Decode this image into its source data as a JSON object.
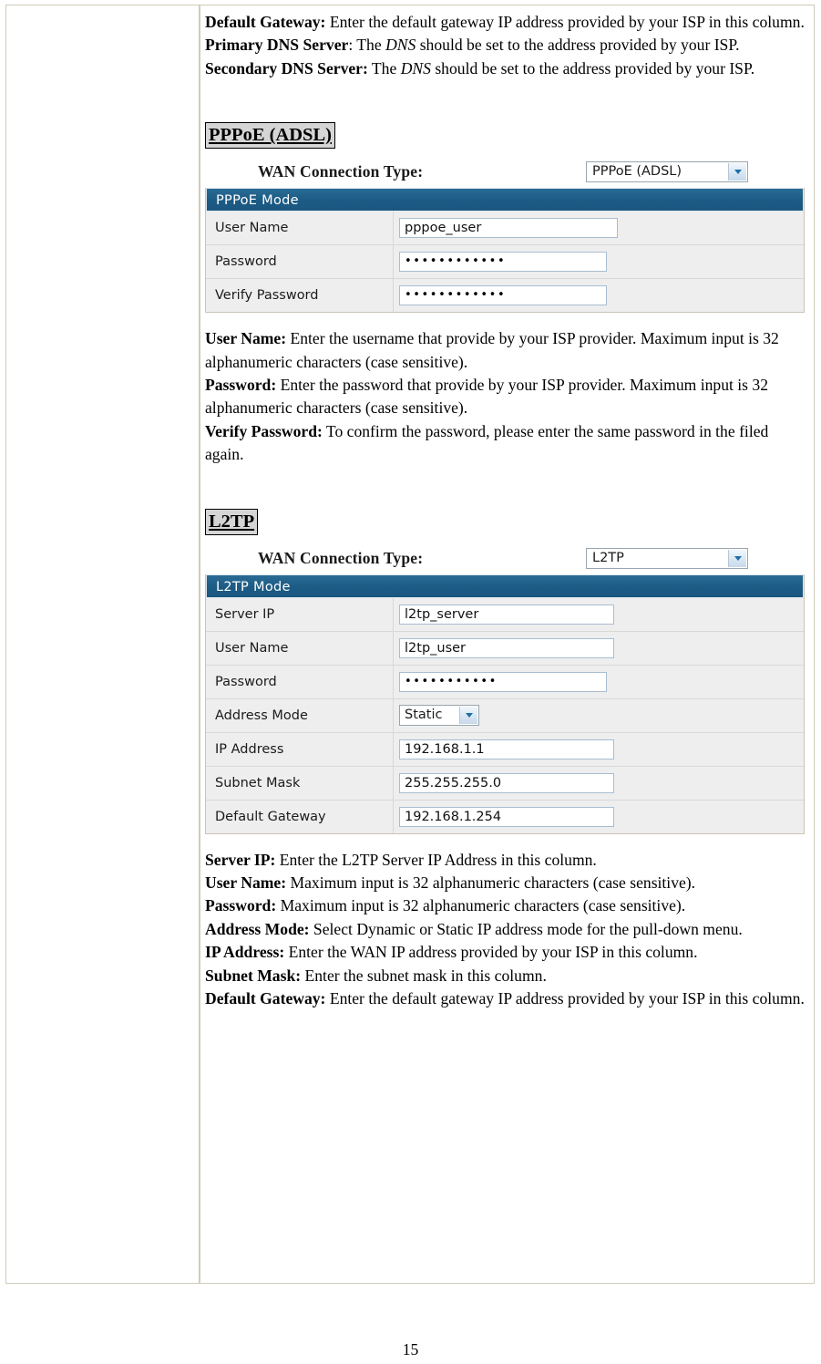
{
  "page": {
    "number": "15"
  },
  "intro": {
    "items": [
      {
        "term": "Default Gateway:",
        "text": " Enter the default gateway IP address provided by your ISP in this column."
      },
      {
        "term": "Primary DNS Server",
        "text_before_em": ": The ",
        "em": "DNS",
        "text_after_em": " should be set to the address provided by your ISP."
      },
      {
        "term": "Secondary DNS Server:",
        "text_before_em": " The ",
        "em": "DNS",
        "text_after_em": " should be set to the address provided by your ISP."
      }
    ]
  },
  "pppoe_section": {
    "heading": "PPPoE (ADSL)",
    "wan_label": "WAN Connection Type:",
    "wan_value": "PPPoE (ADSL)",
    "panel_title": "PPPoE Mode",
    "rows": [
      {
        "label": "User Name",
        "value": "pppoe_user",
        "type": "text"
      },
      {
        "label": "Password",
        "value": "••••••••••••",
        "type": "password"
      },
      {
        "label": "Verify Password",
        "value": "••••••••••••",
        "type": "password"
      }
    ],
    "descriptions": [
      {
        "term": "User Name:",
        "text": " Enter the username that provide by your ISP provider. Maximum input is 32 alphanumeric characters (case sensitive)."
      },
      {
        "term": "Password:",
        "text": " Enter the password that provide by your ISP provider. Maximum input is 32 alphanumeric characters (case sensitive)."
      },
      {
        "term": "Verify Password:",
        "text": " To confirm the password, please enter the same password in the filed again."
      }
    ]
  },
  "l2tp_section": {
    "heading": "L2TP",
    "wan_label": "WAN Connection Type:",
    "wan_value": "L2TP",
    "panel_title": "L2TP Mode",
    "rows": [
      {
        "label": "Server IP",
        "value": "l2tp_server",
        "type": "text"
      },
      {
        "label": "User Name",
        "value": "l2tp_user",
        "type": "text"
      },
      {
        "label": "Password",
        "value": "•••••••••••",
        "type": "password"
      },
      {
        "label": "Address Mode",
        "value": "Static",
        "type": "select"
      },
      {
        "label": "IP Address",
        "value": "192.168.1.1",
        "type": "text"
      },
      {
        "label": "Subnet Mask",
        "value": "255.255.255.0",
        "type": "text"
      },
      {
        "label": "Default Gateway",
        "value": "192.168.1.254",
        "type": "text"
      }
    ],
    "descriptions": [
      {
        "term": "Server IP:",
        "text": " Enter the L2TP Server IP Address in this column."
      },
      {
        "term": "User Name:",
        "text": " Maximum input is 32 alphanumeric characters (case sensitive)."
      },
      {
        "term": "Password:",
        "text": " Maximum input is 32 alphanumeric characters (case sensitive)."
      },
      {
        "term": "Address Mode:",
        "text": " Select Dynamic or Static IP address mode for the pull-down menu."
      },
      {
        "term": "IP Address:",
        "text": " Enter the WAN IP address provided by your ISP in this column."
      },
      {
        "term": "Subnet Mask:",
        "text": " Enter the subnet mask in this column."
      },
      {
        "term": "Default Gateway:",
        "text": " Enter the default gateway IP address provided by your ISP in this column."
      }
    ]
  },
  "colors": {
    "panel_header_blue": "#1c5c85",
    "heading_highlight": "#d5d5d5",
    "table_border": "#cfcbb8"
  }
}
